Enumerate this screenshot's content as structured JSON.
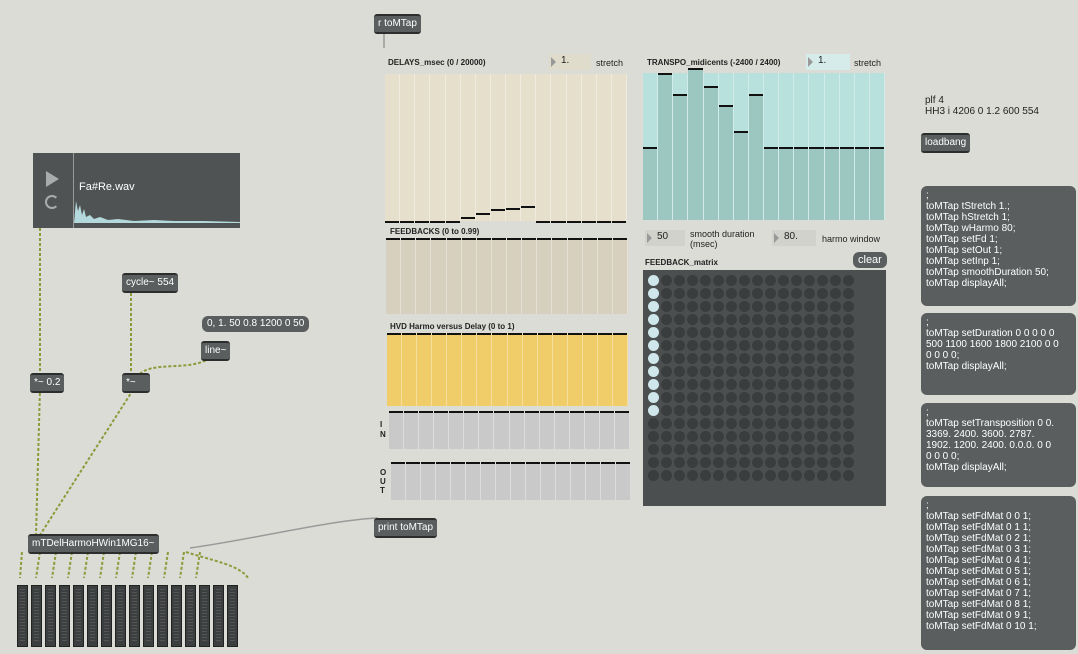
{
  "objects": {
    "r_tomtap": "r toMTap",
    "print_tomtap": "print toMTap",
    "loadbang": "loadbang",
    "cycle": "cycle~ 554",
    "line": "line~",
    "mul_02": "*~ 0.2",
    "mul": "*~",
    "mtdel": "mTDelHarmoHWin1MG16~"
  },
  "messages": {
    "line_msg": "0, 1. 50 0.8 1200 0 50",
    "init": ";\ntoMTap tStretch 1.;\ntoMTap hStretch 1;\ntoMTap wHarmo 80;\ntoMTap setFd 1;\ntoMTap setOut 1;\ntoMTap setInp 1;\ntoMTap smoothDuration 50;\ntoMTap displayAll;",
    "duration": ";\ntoMTap setDuration 0 0 0 0 0\n500 1100 1600 1800 2100 0 0\n0 0 0 0;\ntoMTap displayAll;",
    "transposition": ";\ntoMTap setTransposition 0 0.\n3369. 2400. 3600. 2787.\n1902. 1200. 2400. 0.0.0. 0 0\n0 0 0 0;\ntoMTap displayAll;",
    "fdmat": ";\ntoMTap setFdMat 0 0 1;\ntoMTap setFdMat 0 1 1;\ntoMTap setFdMat 0 2 1;\ntoMTap setFdMat 0 3 1;\ntoMTap setFdMat 0 4 1;\ntoMTap setFdMat 0 5 1;\ntoMTap setFdMat 0 6 1;\ntoMTap setFdMat 0 7 1;\ntoMTap setFdMat 0 8 1;\ntoMTap setFdMat 0 9 1;\ntoMTap setFdMat 0 10 1;",
    "clear": "clear"
  },
  "comments": {
    "plf": "plf 4\nHH3 i 4206 0 1.2 600 554",
    "delays": "DELAYS_msec (0 / 20000)",
    "stretch1": "stretch",
    "transpo": "TRANSPO_midicents (-2400 / 2400)",
    "stretch2": "stretch",
    "feedbacks": "FEEDBACKS (0 to 0.99)",
    "hvd": "HVD Harmo versus Delay (0 to 1)",
    "in_label": "I\nN",
    "out_label": "O\nU\nT",
    "smooth": "smooth duration\n(msec)",
    "harmo_window": "harmo window",
    "feedback_matrix": "FEEDBACK_matrix"
  },
  "numbers": {
    "delay_stretch": "1.",
    "transpo_stretch": "1.",
    "smooth_duration": "50",
    "harmo_window": "80."
  },
  "player": {
    "filename": "Fa#Re.wav"
  },
  "sliders": {
    "delays": [
      0,
      0,
      0,
      0,
      0,
      0.025,
      0.055,
      0.08,
      0.09,
      0.105,
      0,
      0,
      0,
      0,
      0,
      0
    ],
    "transpo": [
      0,
      0.7,
      0.5,
      0.75,
      0.58,
      0.4,
      0.15,
      0.5,
      0,
      0,
      0,
      0,
      0,
      0,
      0,
      0
    ],
    "feedbacks": [
      1,
      1,
      1,
      1,
      1,
      1,
      1,
      1,
      1,
      1,
      1,
      1,
      1,
      1,
      1,
      1
    ],
    "hvd": [
      1,
      1,
      1,
      1,
      1,
      1,
      1,
      1,
      1,
      1,
      1,
      1,
      1,
      1,
      1,
      1
    ],
    "inputs": [
      1,
      1,
      1,
      1,
      1,
      1,
      1,
      1,
      1,
      1,
      1,
      1,
      1,
      1,
      1,
      1
    ],
    "outputs": [
      1,
      1,
      1,
      1,
      1,
      1,
      1,
      1,
      1,
      1,
      1,
      1,
      1,
      1,
      1,
      1
    ]
  },
  "matrix_active_rows": 11,
  "colors": {
    "background": "#dcdcd6",
    "object": "#5a5e5f",
    "delays_panel": "#e6dfcc",
    "transpo_panel": "#b8e0dc",
    "hvd_panel": "#f1cd6a",
    "patch_cord": "#9a9a44"
  }
}
